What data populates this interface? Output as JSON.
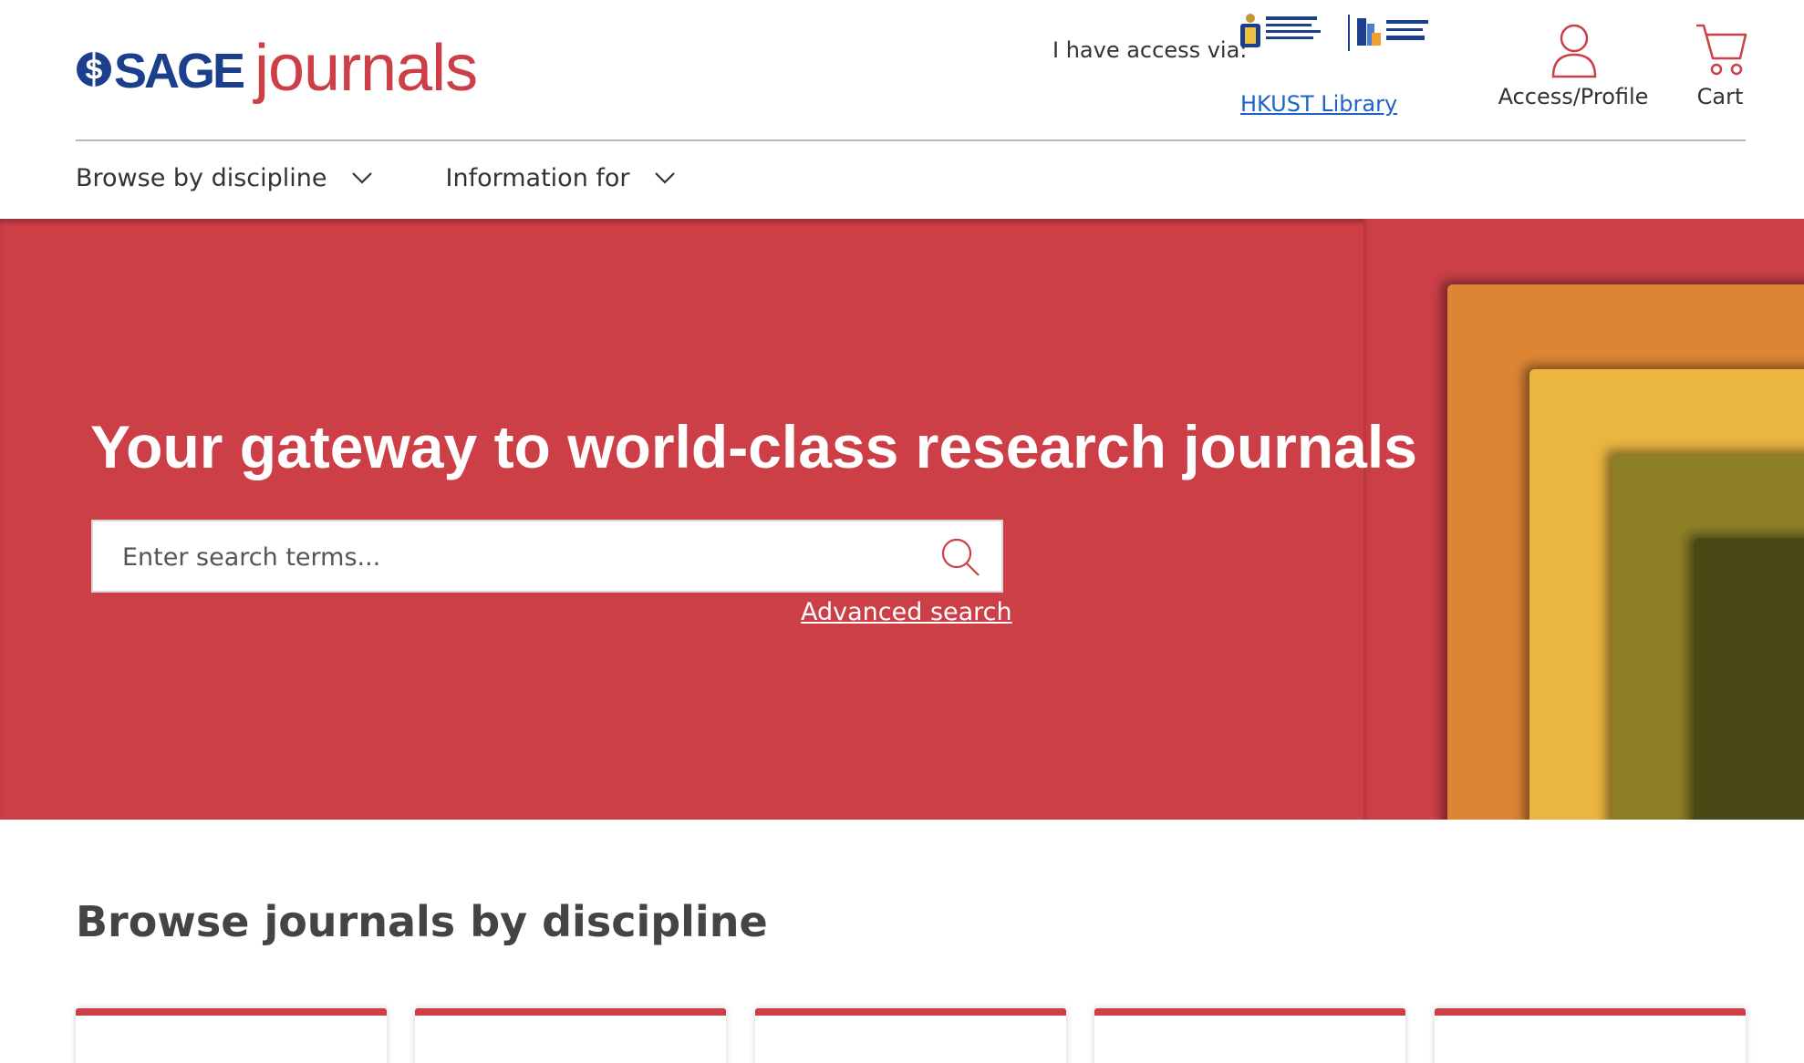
{
  "brand": {
    "logo_primary": "SAGE",
    "logo_secondary": "journals",
    "colors": {
      "brand_red": "#cd3f47",
      "brand_blue": "#1b3f8b",
      "link_blue": "#1e63c5"
    }
  },
  "header": {
    "access_label": "I have access via:",
    "institution_logos": [
      "hkust-logo",
      "lee-shau-kee-library-logo"
    ],
    "institution_link": "HKUST Library",
    "access_profile_label": "Access/Profile",
    "cart_label": "Cart"
  },
  "nav": {
    "items": [
      {
        "label": "Browse by discipline",
        "icon": "chevron-down-icon"
      },
      {
        "label": "Information for",
        "icon": "chevron-down-icon"
      }
    ]
  },
  "hero": {
    "title": "Your gateway to world-class research journals",
    "search_placeholder": "Enter search terms...",
    "search_icon": "search-icon",
    "advanced_search_label": "Advanced search",
    "art_colors": [
      "#dd8530",
      "#eab53f",
      "#8c7f28",
      "#4a4a15"
    ]
  },
  "browse": {
    "title": "Browse journals by discipline",
    "card_count": 5
  }
}
